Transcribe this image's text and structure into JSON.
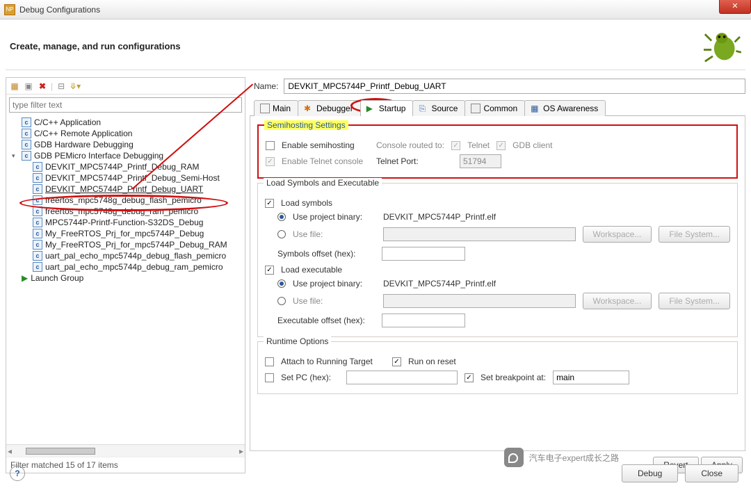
{
  "window": {
    "title": "Debug Configurations"
  },
  "header": {
    "title": "Create, manage, and run configurations"
  },
  "filter": {
    "placeholder": "type filter text",
    "matched": "Filter matched 15 of 17 items"
  },
  "tree": {
    "items": [
      {
        "label": "C/C++ Application"
      },
      {
        "label": "C/C++ Remote Application"
      },
      {
        "label": "GDB Hardware Debugging"
      },
      {
        "label": "GDB PEMicro Interface Debugging"
      }
    ],
    "children": [
      {
        "label": "DEVKIT_MPC5744P_Printf_Debug_RAM"
      },
      {
        "label": "DEVKIT_MPC5744P_Printf_Debug_Semi-Host"
      },
      {
        "label": "DEVKIT_MPC5744P_Printf_Debug_UART"
      },
      {
        "label": "freertos_mpc5748g_debug_flash_pemicro"
      },
      {
        "label": "freertos_mpc5748g_debug_ram_pemicro"
      },
      {
        "label": "MPC5744P-Printf-Function-S32DS_Debug"
      },
      {
        "label": "My_FreeRTOS_Prj_for_mpc5744P_Debug"
      },
      {
        "label": "My_FreeRTOS_Prj_for_mpc5744P_Debug_RAM"
      },
      {
        "label": "uart_pal_echo_mpc5744p_debug_flash_pemicro"
      },
      {
        "label": "uart_pal_echo_mpc5744p_debug_ram_pemicro"
      }
    ],
    "launch_group": "Launch Group"
  },
  "name": {
    "label": "Name:",
    "value": "DEVKIT_MPC5744P_Printf_Debug_UART"
  },
  "tabs": {
    "items": [
      "Main",
      "Debugger",
      "Startup",
      "Source",
      "Common",
      "OS Awareness"
    ],
    "active": 2
  },
  "semi": {
    "legend": "Semihosting Settings",
    "enable_semi": "Enable semihosting",
    "console_routed": "Console routed to:",
    "telnet": "Telnet",
    "gdb_client": "GDB client",
    "enable_telnet": "Enable Telnet console",
    "telnet_port_label": "Telnet Port:",
    "telnet_port_value": "51794"
  },
  "load": {
    "legend": "Load Symbols and Executable",
    "load_symbols": "Load symbols",
    "use_proj_binary": "Use project binary:",
    "proj_value": "DEVKIT_MPC5744P_Printf.elf",
    "use_file": "Use file:",
    "workspace": "Workspace...",
    "filesystem": "File System...",
    "symbols_offset": "Symbols offset (hex):",
    "load_exec": "Load executable",
    "exec_offset": "Executable offset (hex):"
  },
  "runtime": {
    "legend": "Runtime Options",
    "attach": "Attach to Running Target",
    "run_on_reset": "Run on reset",
    "set_pc": "Set PC (hex):",
    "set_breakpoint": "Set breakpoint at:",
    "breakpoint_value": "main"
  },
  "buttons": {
    "revert": "Revert",
    "apply": "Apply",
    "debug": "Debug",
    "close": "Close"
  },
  "watermark": "汽车电子expert成长之路"
}
